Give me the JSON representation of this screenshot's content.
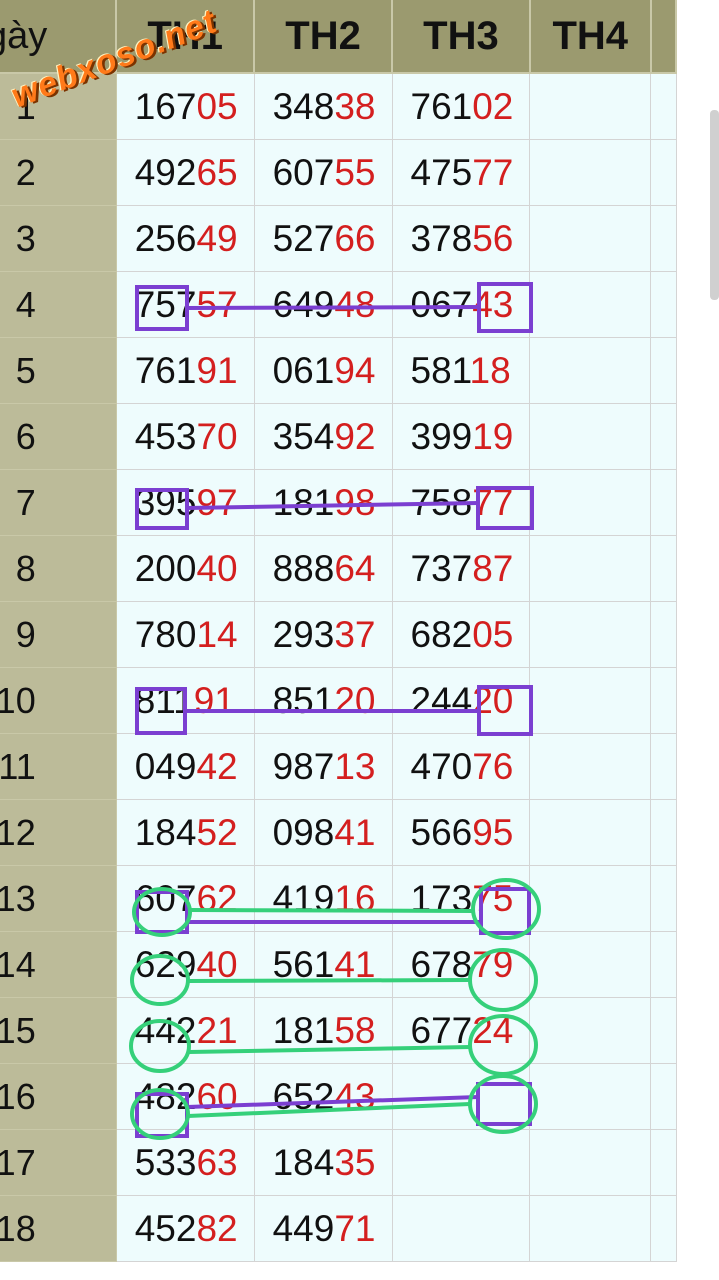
{
  "table": {
    "headers": [
      "Ngày",
      "TH1",
      "TH2",
      "TH3",
      "TH4"
    ],
    "rows": [
      {
        "day": "1",
        "cells": [
          [
            "167",
            "05"
          ],
          [
            "348",
            "38"
          ],
          [
            "761",
            "02"
          ]
        ]
      },
      {
        "day": "2",
        "cells": [
          [
            "492",
            "65"
          ],
          [
            "607",
            "55"
          ],
          [
            "475",
            "77"
          ]
        ]
      },
      {
        "day": "3",
        "cells": [
          [
            "256",
            "49"
          ],
          [
            "527",
            "66"
          ],
          [
            "378",
            "56"
          ]
        ]
      },
      {
        "day": "4",
        "cells": [
          [
            "757",
            "57"
          ],
          [
            "649",
            "48"
          ],
          [
            "067",
            "43"
          ]
        ]
      },
      {
        "day": "5",
        "cells": [
          [
            "761",
            "91"
          ],
          [
            "061",
            "94"
          ],
          [
            "581",
            "18"
          ]
        ]
      },
      {
        "day": "6",
        "cells": [
          [
            "453",
            "70"
          ],
          [
            "354",
            "92"
          ],
          [
            "399",
            "19"
          ]
        ]
      },
      {
        "day": "7",
        "cells": [
          [
            "395",
            "97"
          ],
          [
            "181",
            "98"
          ],
          [
            "758",
            "77"
          ]
        ]
      },
      {
        "day": "8",
        "cells": [
          [
            "200",
            "40"
          ],
          [
            "888",
            "64"
          ],
          [
            "737",
            "87"
          ]
        ]
      },
      {
        "day": "9",
        "cells": [
          [
            "780",
            "14"
          ],
          [
            "293",
            "37"
          ],
          [
            "682",
            "05"
          ]
        ]
      },
      {
        "day": "10",
        "cells": [
          [
            "811",
            "91"
          ],
          [
            "851",
            "20"
          ],
          [
            "244",
            "20"
          ]
        ]
      },
      {
        "day": "11",
        "cells": [
          [
            "049",
            "42"
          ],
          [
            "987",
            "13"
          ],
          [
            "470",
            "76"
          ]
        ]
      },
      {
        "day": "12",
        "cells": [
          [
            "184",
            "52"
          ],
          [
            "098",
            "41"
          ],
          [
            "566",
            "95"
          ]
        ]
      },
      {
        "day": "13",
        "cells": [
          [
            "607",
            "62"
          ],
          [
            "419",
            "16"
          ],
          [
            "173",
            "75"
          ]
        ]
      },
      {
        "day": "14",
        "cells": [
          [
            "629",
            "40"
          ],
          [
            "561",
            "41"
          ],
          [
            "678",
            "79"
          ]
        ]
      },
      {
        "day": "15",
        "cells": [
          [
            "442",
            "21"
          ],
          [
            "181",
            "58"
          ],
          [
            "677",
            "24"
          ]
        ]
      },
      {
        "day": "16",
        "cells": [
          [
            "482",
            "60"
          ],
          [
            "652",
            "43"
          ],
          [
            "",
            ""
          ]
        ]
      },
      {
        "day": "17",
        "cells": [
          [
            "533",
            "63"
          ],
          [
            "184",
            "35"
          ],
          [
            "",
            ""
          ]
        ]
      },
      {
        "day": "18",
        "cells": [
          [
            "452",
            "82"
          ],
          [
            "449",
            "71"
          ],
          [
            "",
            ""
          ]
        ]
      }
    ]
  },
  "watermark": "webxoso.net",
  "colors": {
    "header_bg": "#9b9a6f",
    "day_col_bg": "#bcbb99",
    "cell_bg": "#eefcfd",
    "red_digits": "#d41f1f",
    "purple_mark": "#7b3fd1",
    "green_mark": "#35d07a"
  }
}
